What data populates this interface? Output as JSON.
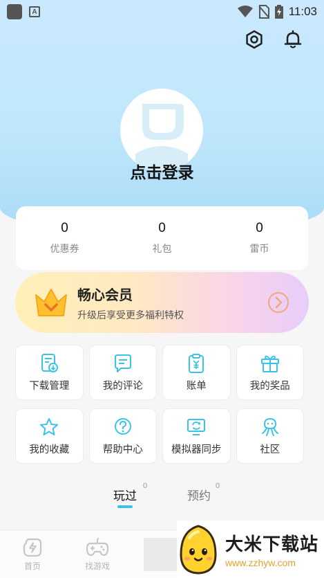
{
  "status_bar": {
    "time": "11:03",
    "notif_letter": "A"
  },
  "header": {
    "login_text": "点击登录"
  },
  "stats": [
    {
      "value": "0",
      "label": "优惠券"
    },
    {
      "value": "0",
      "label": "礼包"
    },
    {
      "value": "0",
      "label": "雷币"
    }
  ],
  "vip": {
    "title": "畅心会员",
    "subtitle": "升级后享受更多福利特权"
  },
  "grid": [
    {
      "label": "下载管理",
      "icon": "download-manage-icon"
    },
    {
      "label": "我的评论",
      "icon": "comment-icon"
    },
    {
      "label": "账单",
      "icon": "bill-icon"
    },
    {
      "label": "我的奖品",
      "icon": "gift-icon"
    },
    {
      "label": "我的收藏",
      "icon": "star-icon"
    },
    {
      "label": "帮助中心",
      "icon": "help-icon"
    },
    {
      "label": "模拟器同步",
      "icon": "sync-icon"
    },
    {
      "label": "社区",
      "icon": "community-icon"
    }
  ],
  "tabs": [
    {
      "label": "玩过",
      "count": "0"
    },
    {
      "label": "预约",
      "count": "0"
    }
  ],
  "bottom_nav": [
    {
      "label": "首页"
    },
    {
      "label": "找游戏"
    }
  ],
  "watermark": {
    "title": "大米下载站",
    "url": "www.zzhyw.com"
  },
  "colors": {
    "accent": "#3bc3e6",
    "top_bg": "#bfe7fb"
  }
}
